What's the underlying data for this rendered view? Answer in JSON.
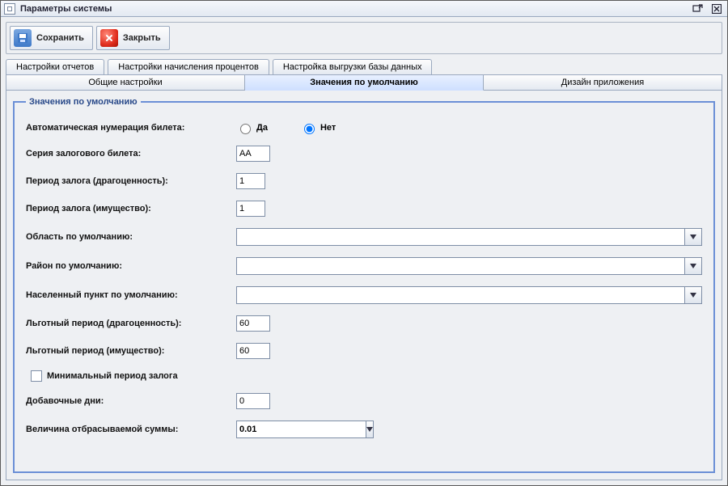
{
  "window": {
    "title": "Параметры системы"
  },
  "toolbar": {
    "save_label": "Сохранить",
    "close_label": "Закрыть"
  },
  "tabs_row1": {
    "t0": "Настройки отчетов",
    "t1": "Настройки начисления процентов",
    "t2": "Настройка выгрузки базы данных"
  },
  "tabs_row2": {
    "t0": "Общие настройки",
    "t1": "Значения по умолчанию",
    "t2": "Дизайн приложения"
  },
  "group": {
    "legend": "Значения по умолчанию"
  },
  "form": {
    "auto_num_label": "Автоматическая нумерация билета:",
    "radio_yes": "Да",
    "radio_no": "Нет",
    "series_label": "Серия залогового билета:",
    "series_value": "AA",
    "period_prec_label": "Период залога (драгоценность):",
    "period_prec_value": "1",
    "period_prop_label": "Период залога (имущество):",
    "period_prop_value": "1",
    "region_label": "Область по умолчанию:",
    "region_value": "",
    "district_label": "Район по умолчанию:",
    "district_value": "",
    "town_label": "Населенный пункт по умолчанию:",
    "town_value": "",
    "grace_prec_label": "Льготный период (драгоценность):",
    "grace_prec_value": "60",
    "grace_prop_label": "Льготный период (имущество):",
    "grace_prop_value": "60",
    "min_period_label": "Минимальный период залога",
    "extra_days_label": "Добавочные дни:",
    "extra_days_value": "0",
    "discard_label": "Величина отбрасываемой суммы:",
    "discard_value": "0.01"
  }
}
